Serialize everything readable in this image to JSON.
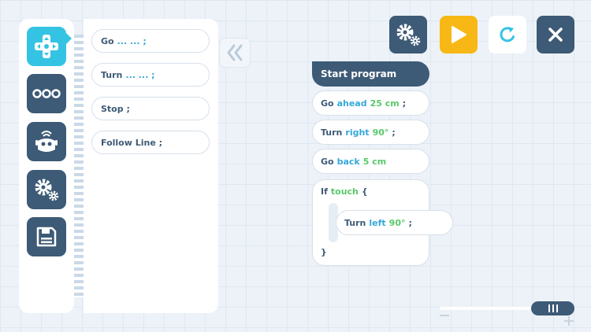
{
  "sidebar": {
    "categories": [
      {
        "icon": "dpad-icon",
        "active": true
      },
      {
        "icon": "more-dots-icon",
        "active": false
      },
      {
        "icon": "robot-icon",
        "active": false
      },
      {
        "icon": "settings-gears-icon",
        "active": false
      },
      {
        "icon": "save-floppy-icon",
        "active": false
      }
    ]
  },
  "palette": {
    "go": {
      "word": "Go",
      "placeholder": "... ... ;"
    },
    "turn": {
      "word": "Turn",
      "placeholder": "... ... ;"
    },
    "stop": {
      "label": "Stop ;"
    },
    "follow_line": {
      "label": "Follow Line ;"
    }
  },
  "toolbar": {
    "settings_icon": "settings-gears-icon",
    "play_icon": "play-icon",
    "reset_icon": "refresh-icon",
    "close_icon": "close-icon"
  },
  "program": {
    "start_label": "Start program",
    "go_ahead": {
      "cmd": "Go",
      "dir": "ahead",
      "val": "25 cm",
      "end": ";"
    },
    "turn_right": {
      "cmd": "Turn",
      "dir": "right",
      "val": "90°",
      "end": ";"
    },
    "go_back": {
      "cmd": "Go",
      "dir": "back",
      "val": "5 cm",
      "end": ";"
    },
    "if_touch": {
      "cmd": "If",
      "cond": "touch",
      "brace": "{"
    },
    "turn_left": {
      "cmd": "Turn",
      "dir": "left",
      "val": "90°",
      "end": ";"
    },
    "close_brace": "}"
  },
  "zoom": {
    "level": 0.85
  },
  "colors": {
    "accent_blue": "#35c3e3",
    "dark_navy": "#3d5a76",
    "play_yellow": "#f7b815",
    "value_green": "#58c96a",
    "direction_blue": "#35a8d8"
  }
}
